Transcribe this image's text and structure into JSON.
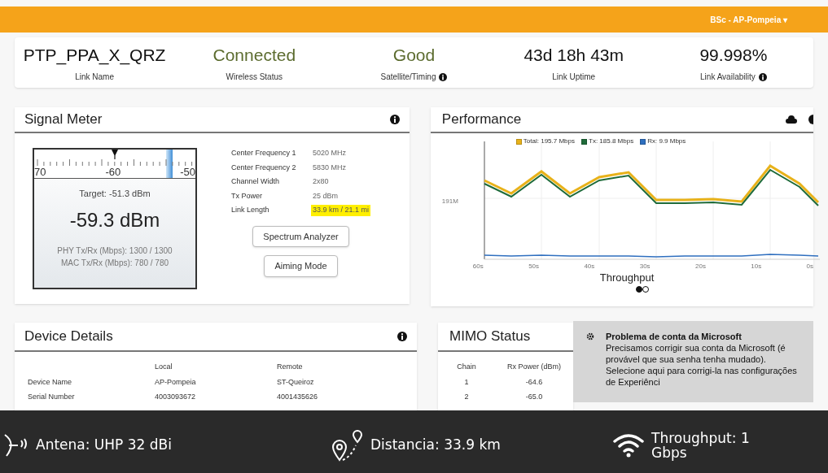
{
  "top_bar": {
    "site_menu": "BSc - AP-Pompeia ▾"
  },
  "summary": [
    {
      "value": "PTP_PPA_X_QRZ",
      "label": "Link Name",
      "kind": "plain",
      "info": false
    },
    {
      "value": "Connected",
      "label": "Wireless Status",
      "kind": "status",
      "info": false
    },
    {
      "value": "Good",
      "label": "Satellite/Timing",
      "kind": "status",
      "info": true
    },
    {
      "value": "43d 18h 43m",
      "label": "Link Uptime",
      "kind": "plain",
      "info": false
    },
    {
      "value": "99.998%",
      "label": "Link Availability",
      "kind": "plain",
      "info": true
    }
  ],
  "signal_meter": {
    "title": "Signal Meter",
    "scale": [
      "70",
      "-60",
      "-50"
    ],
    "level": 0.5,
    "target": "Target: -51.3 dBm",
    "reading": "-59.3 dBm",
    "phy": "PHY Tx/Rx (Mbps): 1300 / 1300",
    "mac": "MAC Tx/Rx (Mbps): 780 / 780",
    "properties": [
      {
        "label": "Center Frequency 1",
        "value": "5020 MHz",
        "highlighted": false
      },
      {
        "label": "Center Frequency 2",
        "value": "5830 MHz",
        "highlighted": false
      },
      {
        "label": "Channel Width",
        "value": "2x80",
        "highlighted": false
      },
      {
        "label": "Tx Power",
        "value": "25 dBm",
        "highlighted": false
      },
      {
        "label": "Link Length",
        "value": "33.9 km / 21.1 mi",
        "highlighted": true
      }
    ],
    "buttons": [
      "Spectrum Analyzer",
      "Aiming Mode"
    ]
  },
  "performance": {
    "title": "Performance",
    "legend": [
      {
        "label": "Total: 195.7 Mbps",
        "color": "#e8b21a"
      },
      {
        "label": "Tx: 185.8 Mbps",
        "color": "#1f6b3a"
      },
      {
        "label": "Rx: 9.9 Mbps",
        "color": "#2f6fbf"
      }
    ],
    "y_label": "191M",
    "x_labels": [
      "60s",
      "50s",
      "40s",
      "30s",
      "20s",
      "10s",
      "0s"
    ],
    "chart_title": "Throughput",
    "pages": [
      {
        "selected": true
      },
      {
        "selected": false
      }
    ]
  },
  "device_details": {
    "title": "Device Details",
    "columns": [
      "Local",
      "Remote"
    ],
    "rows": [
      {
        "label": "Device Name",
        "local": "AP-Pompeia",
        "remote": "ST-Queiroz"
      },
      {
        "label": "Serial Number",
        "local": "4003093672",
        "remote": "4001435626"
      }
    ]
  },
  "mimo_status": {
    "title": "MIMO Status",
    "columns": [
      "Chain",
      "Rx Power (dBm)"
    ],
    "rows": [
      [
        "1",
        "-64.6"
      ],
      [
        "2",
        "-65.0"
      ]
    ]
  },
  "notification": {
    "title": "Problema de conta da Microsoft",
    "body": "Precisamos corrigir sua conta da Microsoft (é provável que sua senha tenha mudado). Selecione aqui para corrigi-la nas configurações de Experiênci"
  },
  "overlay_bar": [
    {
      "kind": "antenna",
      "text": "Antena: UHP 32 dBi"
    },
    {
      "kind": "distance",
      "text": "Distancia: 33.9 km"
    },
    {
      "kind": "wifi",
      "text": "Throughput: 1 Gbps"
    }
  ]
}
